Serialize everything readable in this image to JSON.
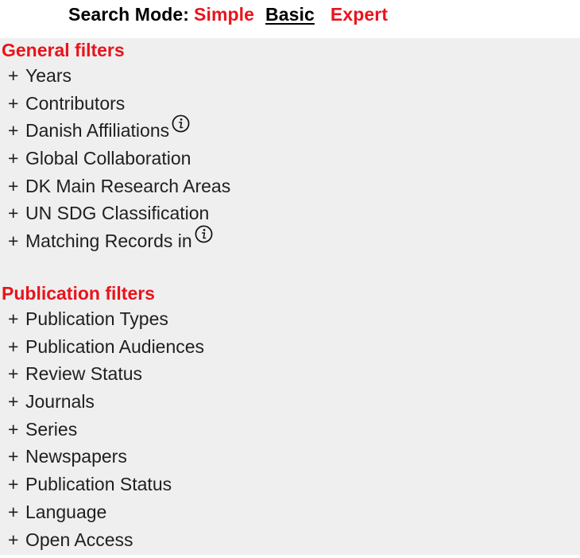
{
  "search_mode": {
    "label": "Search Mode:",
    "options": [
      "Simple",
      "Basic",
      "Expert"
    ],
    "selected": "Basic"
  },
  "general": {
    "title": "General filters",
    "items": [
      {
        "label": "Years"
      },
      {
        "label": "Contributors"
      },
      {
        "label": "Danish Affiliations",
        "info": true
      },
      {
        "label": "Global Collaboration"
      },
      {
        "label": "DK Main Research Areas"
      },
      {
        "label": "UN SDG Classification"
      },
      {
        "label": "Matching Records in",
        "info": true
      }
    ]
  },
  "publication": {
    "title": "Publication filters",
    "items": [
      {
        "label": "Publication Types"
      },
      {
        "label": "Publication Audiences"
      },
      {
        "label": "Review Status"
      },
      {
        "label": "Journals"
      },
      {
        "label": "Series"
      },
      {
        "label": "Newspapers"
      },
      {
        "label": "Publication Status"
      },
      {
        "label": "Language"
      },
      {
        "label": "Open Access"
      }
    ]
  },
  "expand_symbol": "+",
  "colors": {
    "accent": "#e8141c",
    "panel_bg": "#efefef",
    "text": "#1f1f1f"
  }
}
